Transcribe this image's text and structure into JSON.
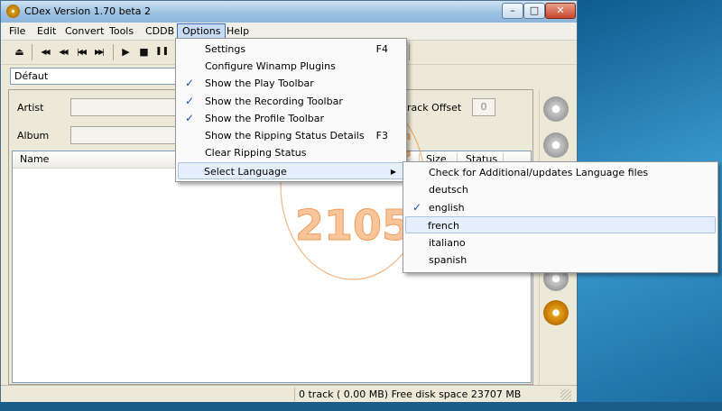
{
  "window": {
    "title": "CDex Version 1.70 beta 2",
    "min_glyph": "–",
    "max_glyph": "□",
    "close_glyph": "✕"
  },
  "menubar": [
    "File",
    "Edit",
    "Convert",
    "Tools",
    "CDDB",
    "Options",
    "Help"
  ],
  "toolbar": {
    "icons": [
      "eject-icon",
      "rewind-start-icon",
      "rewind-icon",
      "previous-icon",
      "forward-icon",
      "play-icon",
      "stop-icon",
      "pause-icon"
    ],
    "glyphs": [
      "⏏",
      "◀◀",
      "◀◀",
      "|◀◀",
      "▶▶|",
      "▶",
      "■",
      "❚❚"
    ]
  },
  "profile": {
    "value": "Défaut",
    "arrow": "▼"
  },
  "fields": {
    "artist_label": "Artist",
    "album_label": "Album",
    "track_offset_label": "rack Offset",
    "track_offset_value": "0"
  },
  "track_list": {
    "columns": [
      "Name",
      "Size",
      "Status"
    ]
  },
  "status": {
    "text": "0 track ( 0.00 MB) Free disk space 23707 MB"
  },
  "watermark": {
    "line1": "MUSIC",
    "line2": "2105"
  },
  "options_menu": {
    "items": [
      {
        "label": "Settings",
        "shortcut": "F4",
        "checked": false
      },
      {
        "label": "Configure Winamp Plugins",
        "shortcut": "",
        "checked": false
      },
      {
        "label": "Show the Play Toolbar",
        "shortcut": "",
        "checked": true
      },
      {
        "label": "Show the Recording Toolbar",
        "shortcut": "",
        "checked": true
      },
      {
        "label": "Show the Profile Toolbar",
        "shortcut": "",
        "checked": true
      },
      {
        "label": "Show the Ripping Status Details",
        "shortcut": "F3",
        "checked": false
      },
      {
        "label": "Clear Ripping Status",
        "shortcut": "",
        "checked": false
      },
      {
        "label": "Select Language",
        "shortcut": "",
        "checked": false,
        "submenu": true
      }
    ],
    "check_glyph": "✓",
    "submenu_glyph": "▶"
  },
  "language_menu": {
    "items": [
      {
        "label": "Check for Additional/updates Language files",
        "checked": false
      },
      {
        "label": "deutsch",
        "checked": false
      },
      {
        "label": "english",
        "checked": true
      },
      {
        "label": "french",
        "checked": false,
        "highlighted": true
      },
      {
        "label": "italiano",
        "checked": false
      },
      {
        "label": "spanish",
        "checked": false
      }
    ]
  },
  "colors": {
    "accent": "#3d6fb5",
    "watermark": "#f07a1e",
    "check": "#1a50b8"
  }
}
